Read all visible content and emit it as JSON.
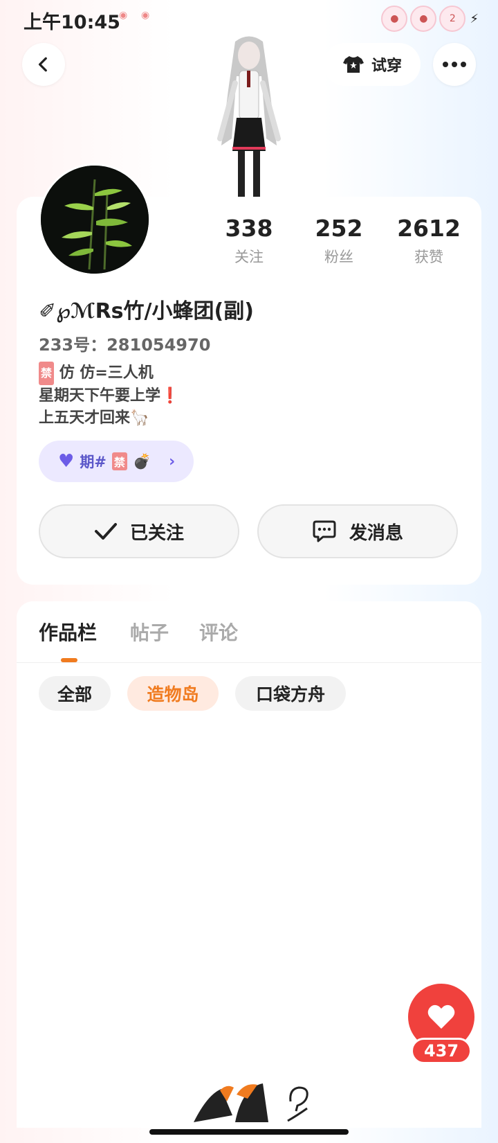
{
  "status_bar": {
    "time": "上午10:45",
    "badge_count": "2"
  },
  "header": {
    "tryon_label": "试穿"
  },
  "profile": {
    "stats": [
      {
        "value": "338",
        "label": "关注"
      },
      {
        "value": "252",
        "label": "粉丝"
      },
      {
        "value": "2612",
        "label": "获赞"
      }
    ],
    "username": "✐℘ℳRs竹/小蜂团(副)",
    "uid": "233号：281054970",
    "bio": {
      "line1_badge": "禁",
      "line1_text": "仿 仿=三人机",
      "line2_text": "星期天下午要上学",
      "line2_mark": "❗",
      "line3_text": "上五天才回来",
      "line3_emoji": "🦙"
    },
    "tag": {
      "prefix": "期#",
      "badge": "禁",
      "emoji": "💣"
    },
    "follow_button": "已关注",
    "message_button": "发消息"
  },
  "tabs": [
    "作品栏",
    "帖子",
    "评论"
  ],
  "active_tab": "作品栏",
  "filters": [
    "全部",
    "造物岛",
    "口袋方舟"
  ],
  "active_filter": "造物岛",
  "like_fab": {
    "count": "437"
  },
  "colors": {
    "accent": "#f07b1f",
    "like_red": "#f0413d",
    "tag_purple": "#6c5ce7"
  }
}
